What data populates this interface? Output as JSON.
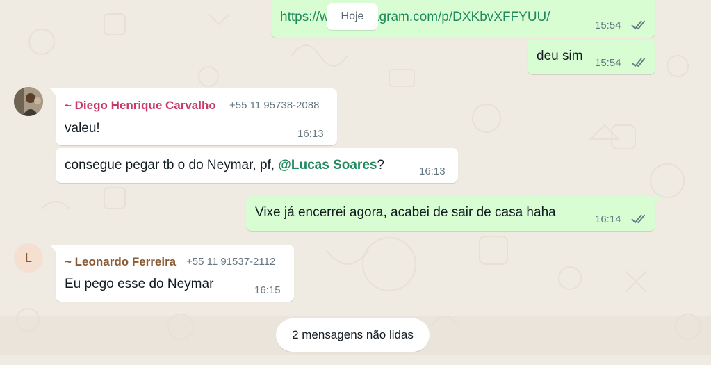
{
  "date_chip": "Hoje",
  "messages": [
    {
      "link": "https://www.instagram.com/p/DXKbvXFFYUU/",
      "time": "15:54"
    },
    {
      "text": "deu sim",
      "time": "15:54"
    },
    {
      "sender": "~ Diego Henrique Carvalho",
      "phone": "+55 11 95738-2088",
      "text": "valeu!",
      "time": "16:13"
    },
    {
      "text_before": "consegue pegar tb o do Neymar, pf, ",
      "mention": "@Lucas Soares",
      "text_after": "?",
      "time": "16:13"
    },
    {
      "text": "Vixe já encerrei agora, acabei de sair de casa haha",
      "time": "16:14"
    },
    {
      "sender": "~ Leonardo Ferreira",
      "phone": "+55 11 91537-2112",
      "avatar_letter": "L",
      "text": "Eu pego esse do Neymar",
      "time": "16:15"
    }
  ],
  "unread_banner": "2 mensagens não lidas",
  "colors": {
    "outgoing_bubble": "#d9fdd3",
    "incoming_bubble": "#ffffff",
    "diego_name": "#c7396b",
    "leonardo_name": "#8a5a33",
    "tick": "#667781"
  }
}
